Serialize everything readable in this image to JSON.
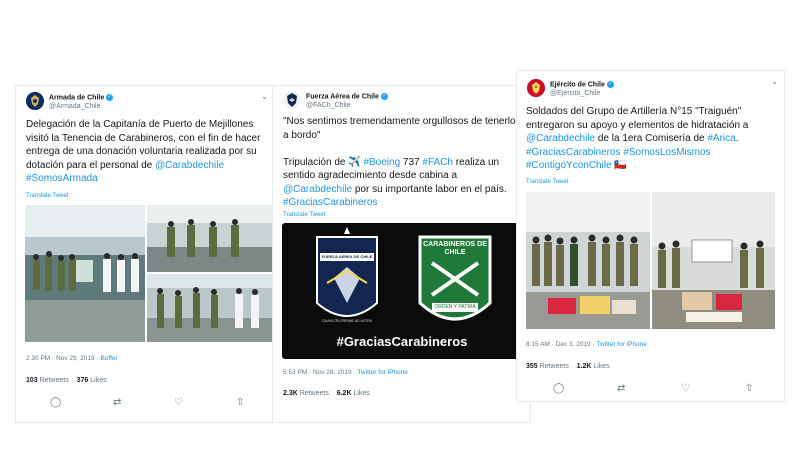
{
  "tweets": [
    {
      "display_name": "Armada de Chile",
      "handle": "@Armada_Chile",
      "text_parts": [
        {
          "t": "Delegación de la Capitanía de Puerto de Mejillones visitó la Tenencia de Carabineros, con el fin de hacer entrega de una donación voluntaria realizada por su dotación para el personal de ",
          "link": false
        },
        {
          "t": "@Carabdechile",
          "link": true
        },
        {
          "t": " ",
          "link": false
        },
        {
          "t": "#SomosArmada",
          "link": true
        }
      ],
      "translate": "Translate Tweet",
      "time": "2:30 PM · Nov 29, 2019 · ",
      "source": "Buffer",
      "retweets": "103",
      "likes": "376",
      "retweets_label": "Retweets",
      "likes_label": "Likes"
    },
    {
      "display_name": "Fuerza Aérea de Chile",
      "handle": "@FACh_Chile",
      "text_parts": [
        {
          "t": "\"Nos sentimos tremendamente orgullosos de tenerlos a bordo\"",
          "link": false
        },
        {
          "br": true
        },
        {
          "br": true
        },
        {
          "t": "Tripulación de ✈️ ",
          "link": false
        },
        {
          "t": "#Boeing",
          "link": true
        },
        {
          "t": " 737 ",
          "link": false
        },
        {
          "t": "#FACh",
          "link": true
        },
        {
          "t": " realiza un sentido agradecimiento desde cabina a ",
          "link": false
        },
        {
          "t": "@Carabdechile",
          "link": true
        },
        {
          "t": " por su importante labor en el país. ",
          "link": false
        },
        {
          "t": "#GraciasCarabineros",
          "link": true
        }
      ],
      "translate": "Translate Tweet",
      "image_caption": "#GraciasCarabineros",
      "badge_fach_top": "FUERZA AEREA DE CHILE",
      "badge_fach_bottom": "QUAM CELERRIME AD ASTRA",
      "badge_carab_top": "CARABINEROS DE CHILE",
      "badge_carab_bottom": "ORDEN Y PATRIA",
      "time": "5:53 PM · Nov 28, 2019 · ",
      "source": "Twitter for iPhone",
      "retweets": "2.3K",
      "likes": "6.2K",
      "retweets_label": "Retweets",
      "likes_label": "Likes"
    },
    {
      "display_name": "Ejército de Chile",
      "handle": "@Ejercito_Chile",
      "text_parts": [
        {
          "t": "Soldados del Grupo de Artillería N°15 \"Traiguén\" entregaron su apoyo y elementos de hidratación a ",
          "link": false
        },
        {
          "t": "@Carabdechile",
          "link": true
        },
        {
          "t": " de la 1era Comisería de ",
          "link": false
        },
        {
          "t": "#Arica",
          "link": true
        },
        {
          "t": ". ",
          "link": false
        },
        {
          "t": "#GraciasCarabineros",
          "link": true
        },
        {
          "t": " ",
          "link": false
        },
        {
          "t": "#SomosLosMismos",
          "link": true
        },
        {
          "t": " ",
          "link": false
        },
        {
          "t": "#ContigoYconChile",
          "link": true
        },
        {
          "t": " 🇨🇱",
          "link": false
        }
      ],
      "translate": "Translate Tweet",
      "time": "8:15 AM · Dec 3, 2019 · ",
      "source": "Twitter for iPhone",
      "retweets": "355",
      "likes": "1.2K",
      "retweets_label": "Retweets",
      "likes_label": "Likes"
    }
  ],
  "icons": [
    "reply-icon",
    "retweet-icon",
    "like-icon",
    "share-icon",
    "chevron-down-icon",
    "verified-icon"
  ],
  "colors": {
    "link": "#1b95e0",
    "muted": "#657786",
    "border": "#e6ecf0",
    "verified": "#1da1f2",
    "carab_green": "#1f7a3a",
    "fach_navy": "#12264f"
  }
}
